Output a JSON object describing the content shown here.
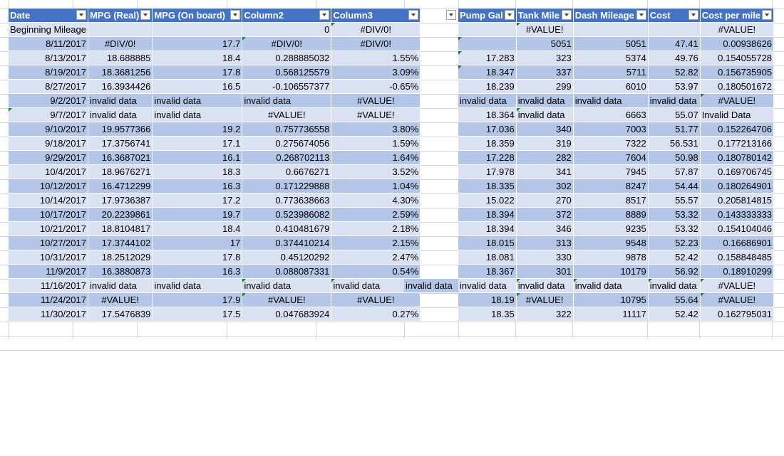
{
  "left_table": {
    "headers": [
      "Date",
      "MPG (Real)",
      "MPG (On board)",
      "Column2",
      "Column3"
    ],
    "rows": [
      [
        "Beginning Mileage",
        "",
        "",
        "0",
        "#DIV/0!"
      ],
      [
        "8/11/2017",
        "#DIV/0!",
        "17.7",
        "#DIV/0!",
        "#DIV/0!"
      ],
      [
        "8/13/2017",
        "18.688885",
        "18.4",
        "0.288885032",
        "1.55%"
      ],
      [
        "8/19/2017",
        "18.3681256",
        "17.8",
        "0.568125579",
        "3.09%"
      ],
      [
        "8/27/2017",
        "16.3934426",
        "16.5",
        "-0.106557377",
        "-0.65%"
      ],
      [
        "9/2/2017",
        "invalid data",
        "invalid data",
        "invalid data",
        "#VALUE!"
      ],
      [
        "9/7/2017",
        "invalid data",
        "invalid data",
        "#VALUE!",
        "#VALUE!"
      ],
      [
        "9/10/2017",
        "19.9577366",
        "19.2",
        "0.757736558",
        "3.80%"
      ],
      [
        "9/18/2017",
        "17.3756741",
        "17.1",
        "0.275674056",
        "1.59%"
      ],
      [
        "9/29/2017",
        "16.3687021",
        "16.1",
        "0.268702113",
        "1.64%"
      ],
      [
        "10/4/2017",
        "18.9676271",
        "18.3",
        "0.6676271",
        "3.52%"
      ],
      [
        "10/12/2017",
        "16.4712299",
        "16.3",
        "0.171229888",
        "1.04%"
      ],
      [
        "10/14/2017",
        "17.9736387",
        "17.2",
        "0.773638663",
        "4.30%"
      ],
      [
        "10/17/2017",
        "20.2239861",
        "19.7",
        "0.523986082",
        "2.59%"
      ],
      [
        "10/21/2017",
        "18.8104817",
        "18.4",
        "0.410481679",
        "2.18%"
      ],
      [
        "10/27/2017",
        "17.3744102",
        "17",
        "0.374410214",
        "2.15%"
      ],
      [
        "10/31/2017",
        "18.2512029",
        "17.8",
        "0.45120292",
        "2.47%"
      ],
      [
        "11/9/2017",
        "16.3880873",
        "16.3",
        "0.088087331",
        "0.54%"
      ],
      [
        "11/16/2017",
        "invalid data",
        "invalid data",
        "invalid data",
        "invalid data"
      ],
      [
        "11/24/2017",
        "#VALUE!",
        "17.9",
        "#VALUE!",
        "#VALUE!"
      ],
      [
        "11/30/2017",
        "17.5476839",
        "17.5",
        "0.047683924",
        "0.27%"
      ]
    ]
  },
  "stray_cell": "invalid data",
  "right_table": {
    "headers": [
      "Pump Gal",
      "Tank Mile",
      "Dash Mileage",
      "Cost",
      "Cost per mile"
    ],
    "rows": [
      [
        "",
        "#VALUE!",
        "",
        "",
        "#VALUE!"
      ],
      [
        "",
        "5051",
        "5051",
        "47.41",
        "0.00938626"
      ],
      [
        "17.283",
        "323",
        "5374",
        "49.76",
        "0.154055728"
      ],
      [
        "18.347",
        "337",
        "5711",
        "52.82",
        "0.156735905"
      ],
      [
        "18.239",
        "299",
        "6010",
        "53.97",
        "0.180501672"
      ],
      [
        "invalid data",
        "invalid data",
        "invalid data",
        "invalid data",
        "#VALUE!"
      ],
      [
        "18.364",
        "invalid data",
        "6663",
        "55.07",
        "Invalid Data"
      ],
      [
        "17.036",
        "340",
        "7003",
        "51.77",
        "0.152264706"
      ],
      [
        "18.359",
        "319",
        "7322",
        "56.531",
        "0.177213166"
      ],
      [
        "17.228",
        "282",
        "7604",
        "50.98",
        "0.180780142"
      ],
      [
        "17.978",
        "341",
        "7945",
        "57.87",
        "0.169706745"
      ],
      [
        "18.335",
        "302",
        "8247",
        "54.44",
        "0.180264901"
      ],
      [
        "15.022",
        "270",
        "8517",
        "55.57",
        "0.205814815"
      ],
      [
        "18.394",
        "372",
        "8889",
        "53.32",
        "0.143333333"
      ],
      [
        "18.394",
        "346",
        "9235",
        "53.32",
        "0.154104046"
      ],
      [
        "18.015",
        "313",
        "9548",
        "52.23",
        "0.16686901"
      ],
      [
        "18.081",
        "330",
        "9878",
        "52.42",
        "0.158848485"
      ],
      [
        "18.367",
        "301",
        "10179",
        "56.92",
        "0.18910299"
      ],
      [
        "invalid data",
        "invalid data",
        "invalid data",
        "invalid data",
        "#VALUE!"
      ],
      [
        "18.19",
        "#VALUE!",
        "10795",
        "55.64",
        "#VALUE!"
      ],
      [
        "18.35",
        "322",
        "11117",
        "52.42",
        "0.162795031"
      ]
    ]
  },
  "colors": {
    "header": "#4472c4",
    "band_light": "#d9e1f2",
    "band_dark": "#b4c6e7",
    "gridline": "#d4d4d4",
    "error_triangle": "#1e7b34"
  },
  "icons": {
    "filter_dropdown": "chevron-down-icon",
    "error_indicator": "error-triangle-icon"
  }
}
